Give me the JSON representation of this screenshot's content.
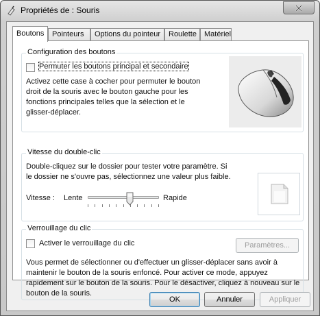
{
  "window": {
    "title": "Propriétés de : Souris"
  },
  "tabs": [
    {
      "label": "Boutons"
    },
    {
      "label": "Pointeurs"
    },
    {
      "label": "Options du pointeur"
    },
    {
      "label": "Roulette"
    },
    {
      "label": "Matériel"
    }
  ],
  "buttons_config": {
    "title": "Configuration des boutons",
    "checkbox_label": "Permuter les boutons principal et secondaire",
    "checked": false,
    "description": "Activez cette case à cocher pour permuter le bouton droit de la souris avec le bouton gauche pour les fonctions principales telles que la sélection et le glisser-déplacer."
  },
  "double_click": {
    "title": "Vitesse du double-clic",
    "description": "Double-cliquez sur le dossier pour tester votre paramètre. Si le dossier ne s'ouvre pas, sélectionnez une valeur plus faible.",
    "speed_label": "Vitesse :",
    "slow_label": "Lente",
    "fast_label": "Rapide",
    "speed_value_fraction": 0.6
  },
  "click_lock": {
    "title": "Verrouillage du clic",
    "checkbox_label": "Activer le verrouillage du clic",
    "checked": false,
    "settings_button": "Paramètres...",
    "description": "Vous permet de sélectionner ou d'effectuer un glisser-déplacer sans avoir à maintenir le bouton de la souris enfoncé. Pour activer ce mode, appuyez rapidement sur le bouton de la souris. Pour le désactiver, cliquez à nouveau sur le bouton de la souris."
  },
  "footer": {
    "ok": "OK",
    "cancel": "Annuler",
    "apply": "Appliquer"
  },
  "icons": {
    "title": "mouse-properties-icon",
    "close": "close-icon",
    "mouse": "mouse-illustration-icon",
    "folder": "test-folder-icon"
  }
}
